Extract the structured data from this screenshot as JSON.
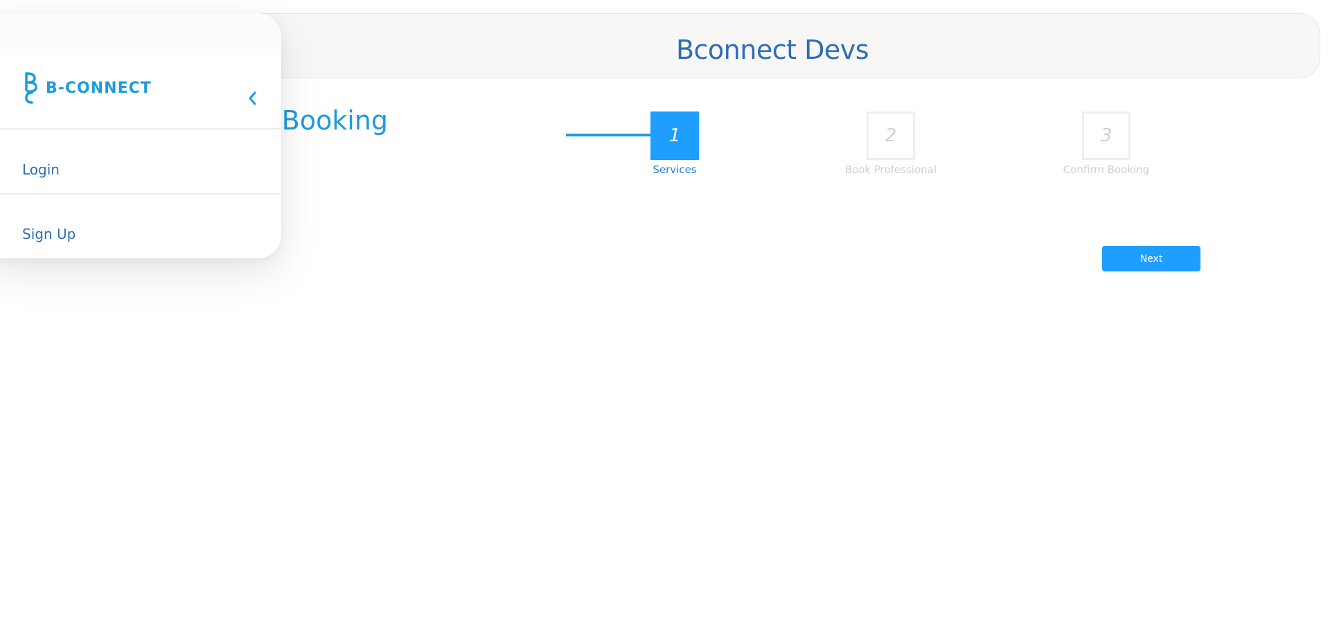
{
  "header": {
    "title": "Bconnect Devs"
  },
  "page": {
    "heading": "Book Booking"
  },
  "stepper": {
    "steps": [
      {
        "number": "1",
        "label": "Services",
        "state": "active"
      },
      {
        "number": "2",
        "label": "Book Professional",
        "state": "inactive"
      },
      {
        "number": "3",
        "label": "Confirm Booking",
        "state": "inactive"
      }
    ]
  },
  "actions": {
    "next_label": "Next"
  },
  "sidebar": {
    "logo_text": "B-CONNECT",
    "collapse_icon": "chevron-left-icon",
    "items": [
      {
        "label": "Login"
      },
      {
        "label": "Sign Up"
      }
    ]
  },
  "colors": {
    "accent": "#1e9eff",
    "brand": "#1e9bde",
    "text_blue": "#2d6db5",
    "inactive": "#d0d0d0"
  }
}
